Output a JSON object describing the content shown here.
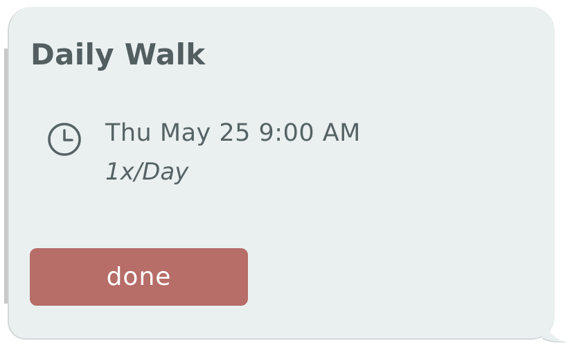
{
  "card": {
    "title": "Daily Walk",
    "schedule": {
      "icon": "clock-icon",
      "datetime": "Thu May 25 9:00 AM",
      "frequency": "1x/Day"
    },
    "done_label": "done"
  },
  "colors": {
    "card_bg": "#eaf0f0",
    "text": "#525e60",
    "button_bg": "#b76d68",
    "button_text": "#ffffff"
  }
}
